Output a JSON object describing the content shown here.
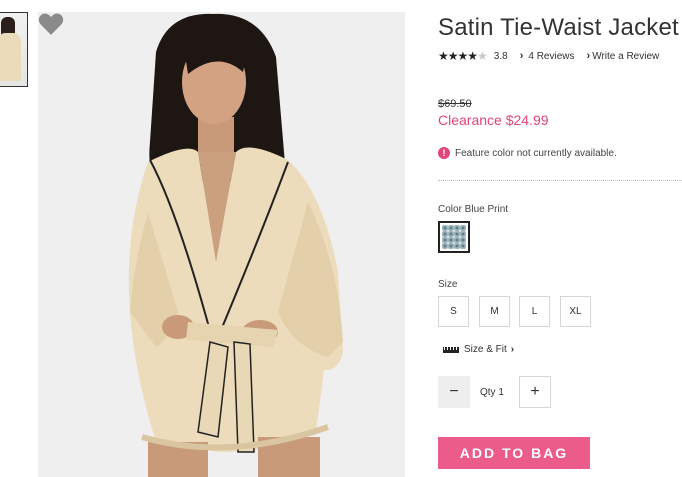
{
  "product": {
    "title": "Satin Tie-Waist Jacket",
    "rating": {
      "stars_filled": 4,
      "stars_total": 5,
      "value": "3.8",
      "reviews_label": "4 Reviews",
      "write_review_label": "Write a Review"
    },
    "price": {
      "original": "$69.50",
      "clearance": "Clearance $24.99"
    },
    "notice": "Feature color not currently available.",
    "color": {
      "label": "Color Blue Print",
      "swatch_color": "#9fb6bd"
    },
    "size": {
      "label": "Size",
      "options": [
        "S",
        "M",
        "L",
        "XL"
      ]
    },
    "size_fit_label": "Size & Fit",
    "quantity_label": "Qty 1",
    "add_to_bag_label": "ADD TO BAG"
  },
  "colors": {
    "accent_pink": "#e0457b",
    "button_pink": "#eb5c8b",
    "image_bg": "#efefef",
    "heart_grey": "#8a8a8a"
  },
  "icons": {
    "favorite": "heart-icon",
    "notice": "alert-circle-icon",
    "size_fit": "ruler-icon",
    "minus": "minus-icon",
    "plus": "plus-icon"
  }
}
